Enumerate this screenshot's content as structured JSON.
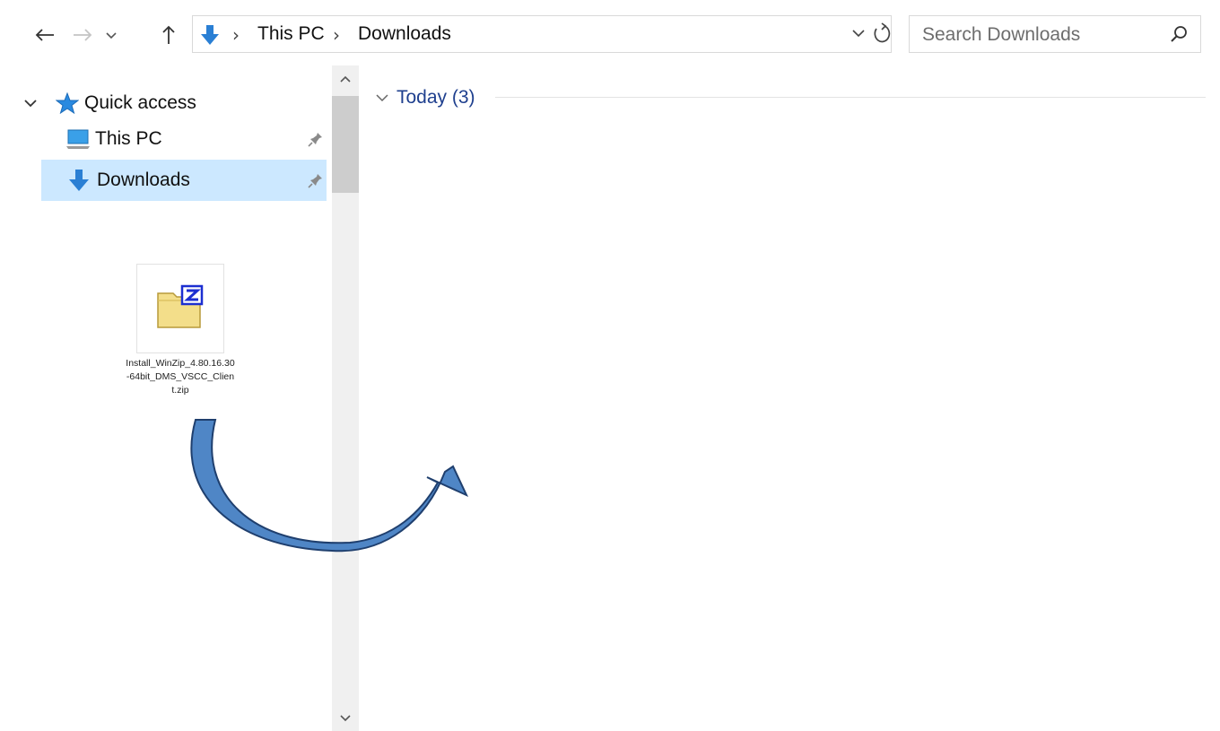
{
  "nav": {
    "back_icon": "arrow-left-icon",
    "forward_icon": "arrow-right-icon",
    "recent_icon": "chevron-down-icon",
    "up_icon": "arrow-up-icon"
  },
  "address_bar": {
    "breadcrumbs": [
      "This PC",
      "Downloads"
    ],
    "refresh_icon": "refresh-icon"
  },
  "search": {
    "placeholder": "Search Downloads",
    "icon": "search-icon"
  },
  "sidebar": {
    "items": [
      {
        "label": "Quick access",
        "icon": "star-icon",
        "expanded": true
      },
      {
        "label": "This PC",
        "icon": "computer-icon",
        "pinned": true
      },
      {
        "label": "Downloads",
        "icon": "download-icon",
        "pinned": true,
        "selected": true
      }
    ]
  },
  "content": {
    "group_title": "Today (3)"
  },
  "file": {
    "name": "Install_WinZip_4.80.16.30-64bit_DMS_VSCC_Client.zip",
    "icon": "zip-archive-icon"
  },
  "colors": {
    "accent": "#1e3f8e",
    "selected_bg": "#cce8ff",
    "arrow_fill": "#4a7fc4"
  }
}
